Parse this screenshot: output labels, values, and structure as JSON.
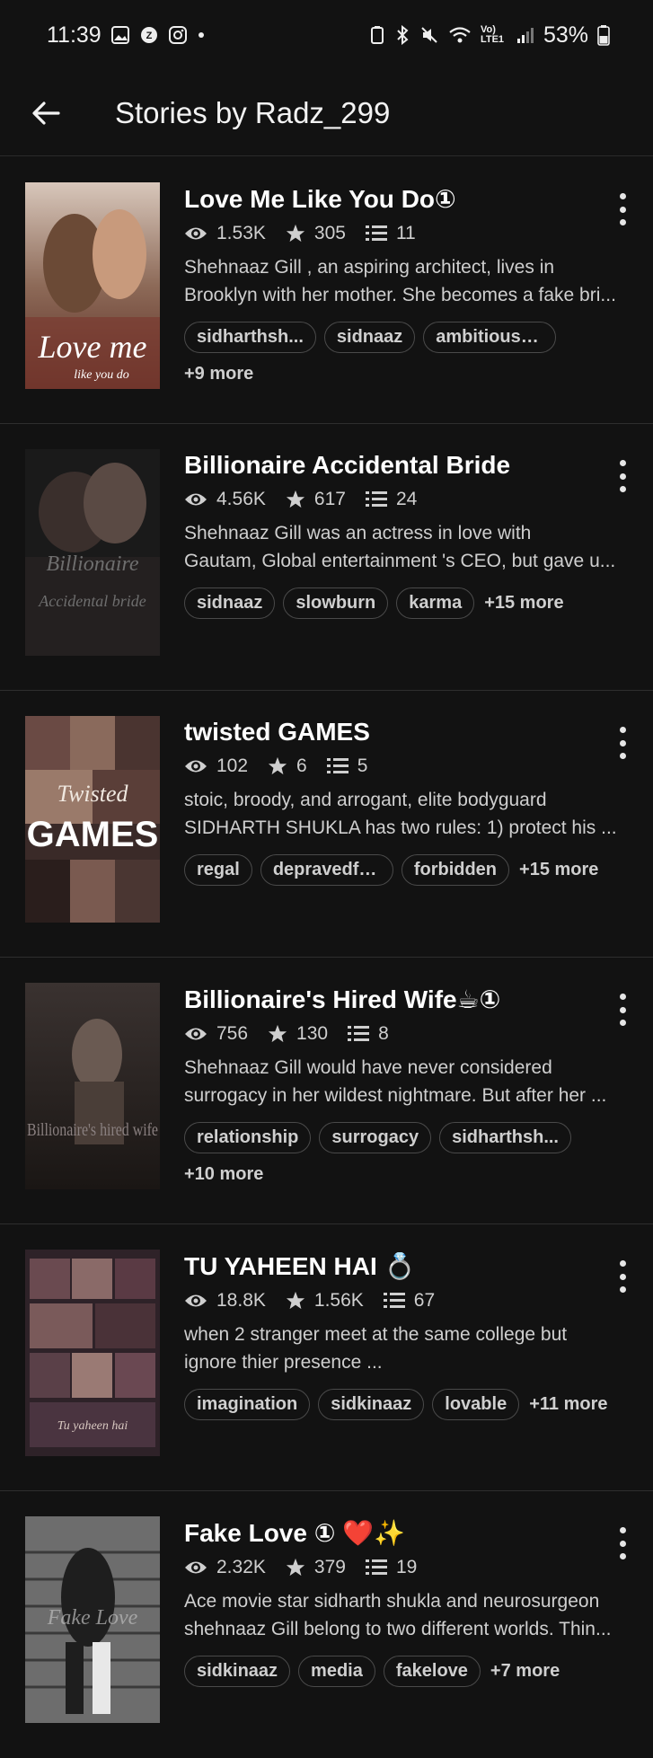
{
  "status_bar": {
    "time": "11:39",
    "battery": "53%",
    "network": "Vo) LTE1"
  },
  "app_bar": {
    "title": "Stories by Radz_299"
  },
  "stories": [
    {
      "title": "Love Me Like You Do①",
      "views": "1.53K",
      "stars": "305",
      "parts": "11",
      "desc_line1": "Shehnaaz Gill , an aspiring architect, lives in",
      "desc_line2": "Brooklyn with her mother. She becomes a fake bri...",
      "tags": [
        "sidharthsh...",
        "sidnaaz",
        "ambitiousg..."
      ],
      "more": "+9 more",
      "cover_text": "Love me",
      "cover_sub": "like you do"
    },
    {
      "title": "Billionaire Accidental Bride",
      "views": "4.56K",
      "stars": "617",
      "parts": "24",
      "desc_line1": "Shehnaaz Gill was an actress in love with",
      "desc_line2": "Gautam, Global entertainment 's CEO, but gave u...",
      "tags": [
        "sidnaaz",
        "slowburn",
        "karma"
      ],
      "more": "+15 more",
      "cover_text": "Billionaire",
      "cover_sub": "Accidental bride"
    },
    {
      "title": "twisted GAMES",
      "views": "102",
      "stars": "6",
      "parts": "5",
      "desc_line1": "stoic, broody, and arrogant, elite bodyguard",
      "desc_line2": "SIDHARTH SHUKLA has two rules: 1) protect his ...",
      "tags": [
        "regal",
        "depravedfa...",
        "forbidden"
      ],
      "more": "+15 more",
      "cover_text": "GAMES",
      "cover_sub": "Twisted"
    },
    {
      "title": "Billionaire's Hired Wife☕①",
      "views": "756",
      "stars": "130",
      "parts": "8",
      "desc_line1": "Shehnaaz Gill would have never considered",
      "desc_line2": "surrogacy in her wildest nightmare. But after her ...",
      "tags": [
        "relationship",
        "surrogacy",
        "sidharthsh..."
      ],
      "more": "+10 more",
      "cover_text": "Billionaire's hired wife",
      "cover_sub": ""
    },
    {
      "title": "TU YAHEEN HAI 💍",
      "views": "18.8K",
      "stars": "1.56K",
      "parts": "67",
      "desc_line1": "when 2 stranger meet at the same college but",
      "desc_line2": "ignore thier presence ...",
      "tags": [
        "imagination",
        "sidkinaaz",
        "lovable"
      ],
      "more": "+11 more",
      "cover_text": "Tu yaheen hai",
      "cover_sub": ""
    },
    {
      "title": "Fake Love ① ❤️✨",
      "views": "2.32K",
      "stars": "379",
      "parts": "19",
      "desc_line1": "Ace movie star sidharth shukla and neurosurgeon",
      "desc_line2": "shehnaaz Gill belong to two different worlds. Thin...",
      "tags": [
        "sidkinaaz",
        "media",
        "fakelove"
      ],
      "more": "+7 more",
      "cover_text": "Fake Love",
      "cover_sub": ""
    }
  ],
  "colors": {
    "background": "#121212",
    "text": "#ffffff",
    "muted": "#cfcfcf",
    "divider": "#2e2e2e"
  }
}
